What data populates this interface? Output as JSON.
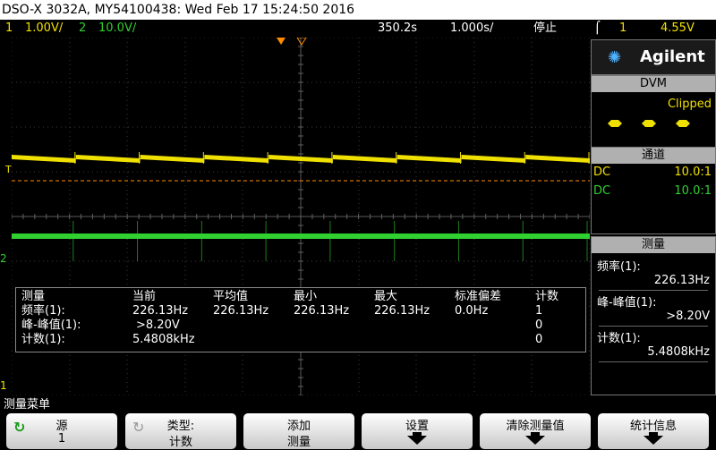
{
  "title": "DSO-X 3032A, MY54100438: Wed Feb 17 15:24:50 2016",
  "status": {
    "ch1_num": "1",
    "ch1_scale": "1.00V/",
    "ch2_num": "2",
    "ch2_scale": "10.0V/",
    "delay": "350.2s",
    "timebase": "1.000s/",
    "run_state": "停止",
    "trigger_icon": "⌠",
    "trigger_src": "1",
    "trigger_level": "4.55V"
  },
  "markers": {
    "trigger_T": "T",
    "ch2_marker": "2",
    "ch1_marker": "1"
  },
  "measurements": {
    "headers": [
      "测量",
      "当前",
      "平均值",
      "最小",
      "最大",
      "标准偏差",
      "计数"
    ],
    "rows": [
      [
        "频率(1):",
        "226.13Hz",
        "226.13Hz",
        "226.13Hz",
        "226.13Hz",
        "0.0Hz",
        "1"
      ],
      [
        "峰-峰值(1):",
        ">8.20V",
        "",
        "",
        "",
        "",
        "0"
      ],
      [
        "计数(1):",
        "5.4808kHz",
        "",
        "",
        "",
        "",
        "0"
      ]
    ]
  },
  "panel": {
    "brand": "Agilent",
    "dvm_title": "DVM",
    "dvm_status": "Clipped",
    "channels_title": "通道",
    "channels": [
      {
        "coupling": "DC",
        "probe": "10.0:1",
        "color": "#f0e000"
      },
      {
        "coupling": "DC",
        "probe": "10.0:1",
        "color": "#30d030"
      }
    ],
    "meas_title": "测量",
    "meas": [
      {
        "label": "频率(1):",
        "value": "226.13Hz"
      },
      {
        "label": "峰-峰值(1):",
        "value": ">8.20V"
      },
      {
        "label": "计数(1):",
        "value": "5.4808kHz"
      }
    ]
  },
  "menu": {
    "title": "测量菜单",
    "softkeys": [
      {
        "l1": "源",
        "l2": "1"
      },
      {
        "l1": "类型:",
        "l2": "计数"
      },
      {
        "l1": "添加",
        "l2": "测量"
      },
      {
        "l1": "设置",
        "l2": ""
      },
      {
        "l1": "清除测量值",
        "l2": ""
      },
      {
        "l1": "统计信息",
        "l2": ""
      }
    ]
  },
  "colors": {
    "ch1": "#f0e000",
    "ch2": "#30d030",
    "trigger": "#ff8c00"
  }
}
